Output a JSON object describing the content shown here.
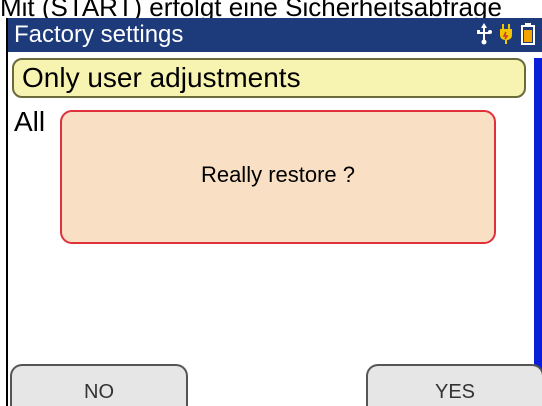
{
  "caption": "Mit (START) erfolgt eine Sicherheitsabfrage",
  "header": {
    "title": "Factory settings",
    "icons": [
      "usb-icon",
      "power-plug-icon",
      "battery-icon"
    ]
  },
  "options": [
    {
      "label": "Only user adjustments",
      "selected": true
    },
    {
      "label": "All",
      "selected": false
    }
  ],
  "dialog": {
    "message": "Really restore ?"
  },
  "softkeys": {
    "left": "NO",
    "right": "YES"
  },
  "colors": {
    "titlebar": "#1d3a7a",
    "selected_option_bg": "#f7f3b0",
    "dialog_bg": "#f9dfc3",
    "dialog_border": "#e0303a",
    "scrollbar": "#0a1fd8"
  }
}
